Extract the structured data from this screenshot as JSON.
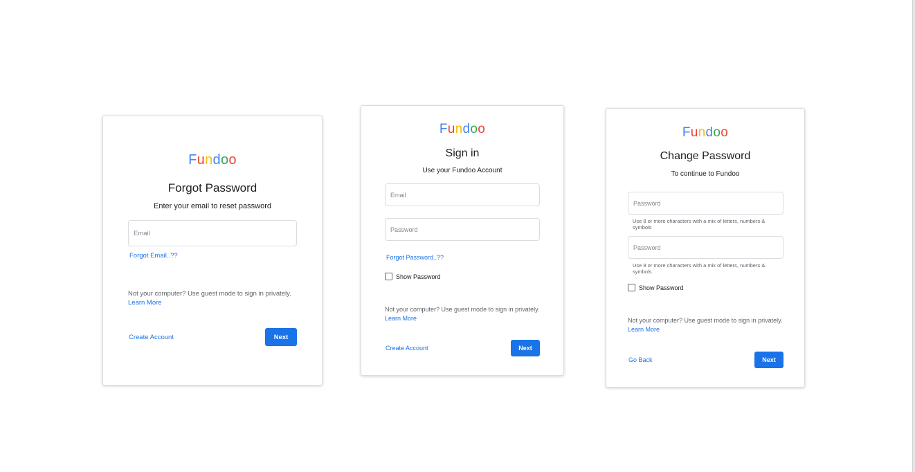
{
  "logo": [
    "F",
    "u",
    "n",
    "d",
    "o",
    "o"
  ],
  "forgot_card": {
    "title": "Forgot Password",
    "subtitle": "Enter your email to reset password",
    "email_placeholder": "Email",
    "forgot_email_link": "Forgot Email..??",
    "guest_text": "Not your computer? Use guest mode to sign in privately.",
    "learn_more": "Learn More",
    "create_account": "Create Account",
    "next": "Next"
  },
  "signin_card": {
    "title": "Sign in",
    "subtitle": "Use your Fundoo Account",
    "email_placeholder": "Email",
    "password_placeholder": "Password",
    "forgot_password_link": "Forgot Password..??",
    "show_password": "Show Password",
    "guest_text": "Not your computer? Use guest mode to sign in privately.",
    "learn_more": "Learn More",
    "create_account": "Create Account",
    "next": "Next"
  },
  "change_card": {
    "title": "Change Password",
    "subtitle": "To continue to Fundoo",
    "password_placeholder": "Password",
    "password_hint": "Use 8 or more characters with a mix of letters, numbers & symbols",
    "confirm_placeholder": "Password",
    "confirm_hint": "Use 8 or more characters with a mix of letters, numbers & symbols",
    "show_password": "Show Password",
    "guest_text": "Not your computer? Use guest mode to sign in privately.",
    "learn_more": "Learn More",
    "go_back": "Go Back",
    "next": "Next"
  },
  "colors": {
    "primary": "#1a73e8",
    "logo_blue": "#4285f4",
    "logo_red": "#ea4335",
    "logo_yellow": "#fbbc05",
    "logo_green": "#34a853"
  }
}
